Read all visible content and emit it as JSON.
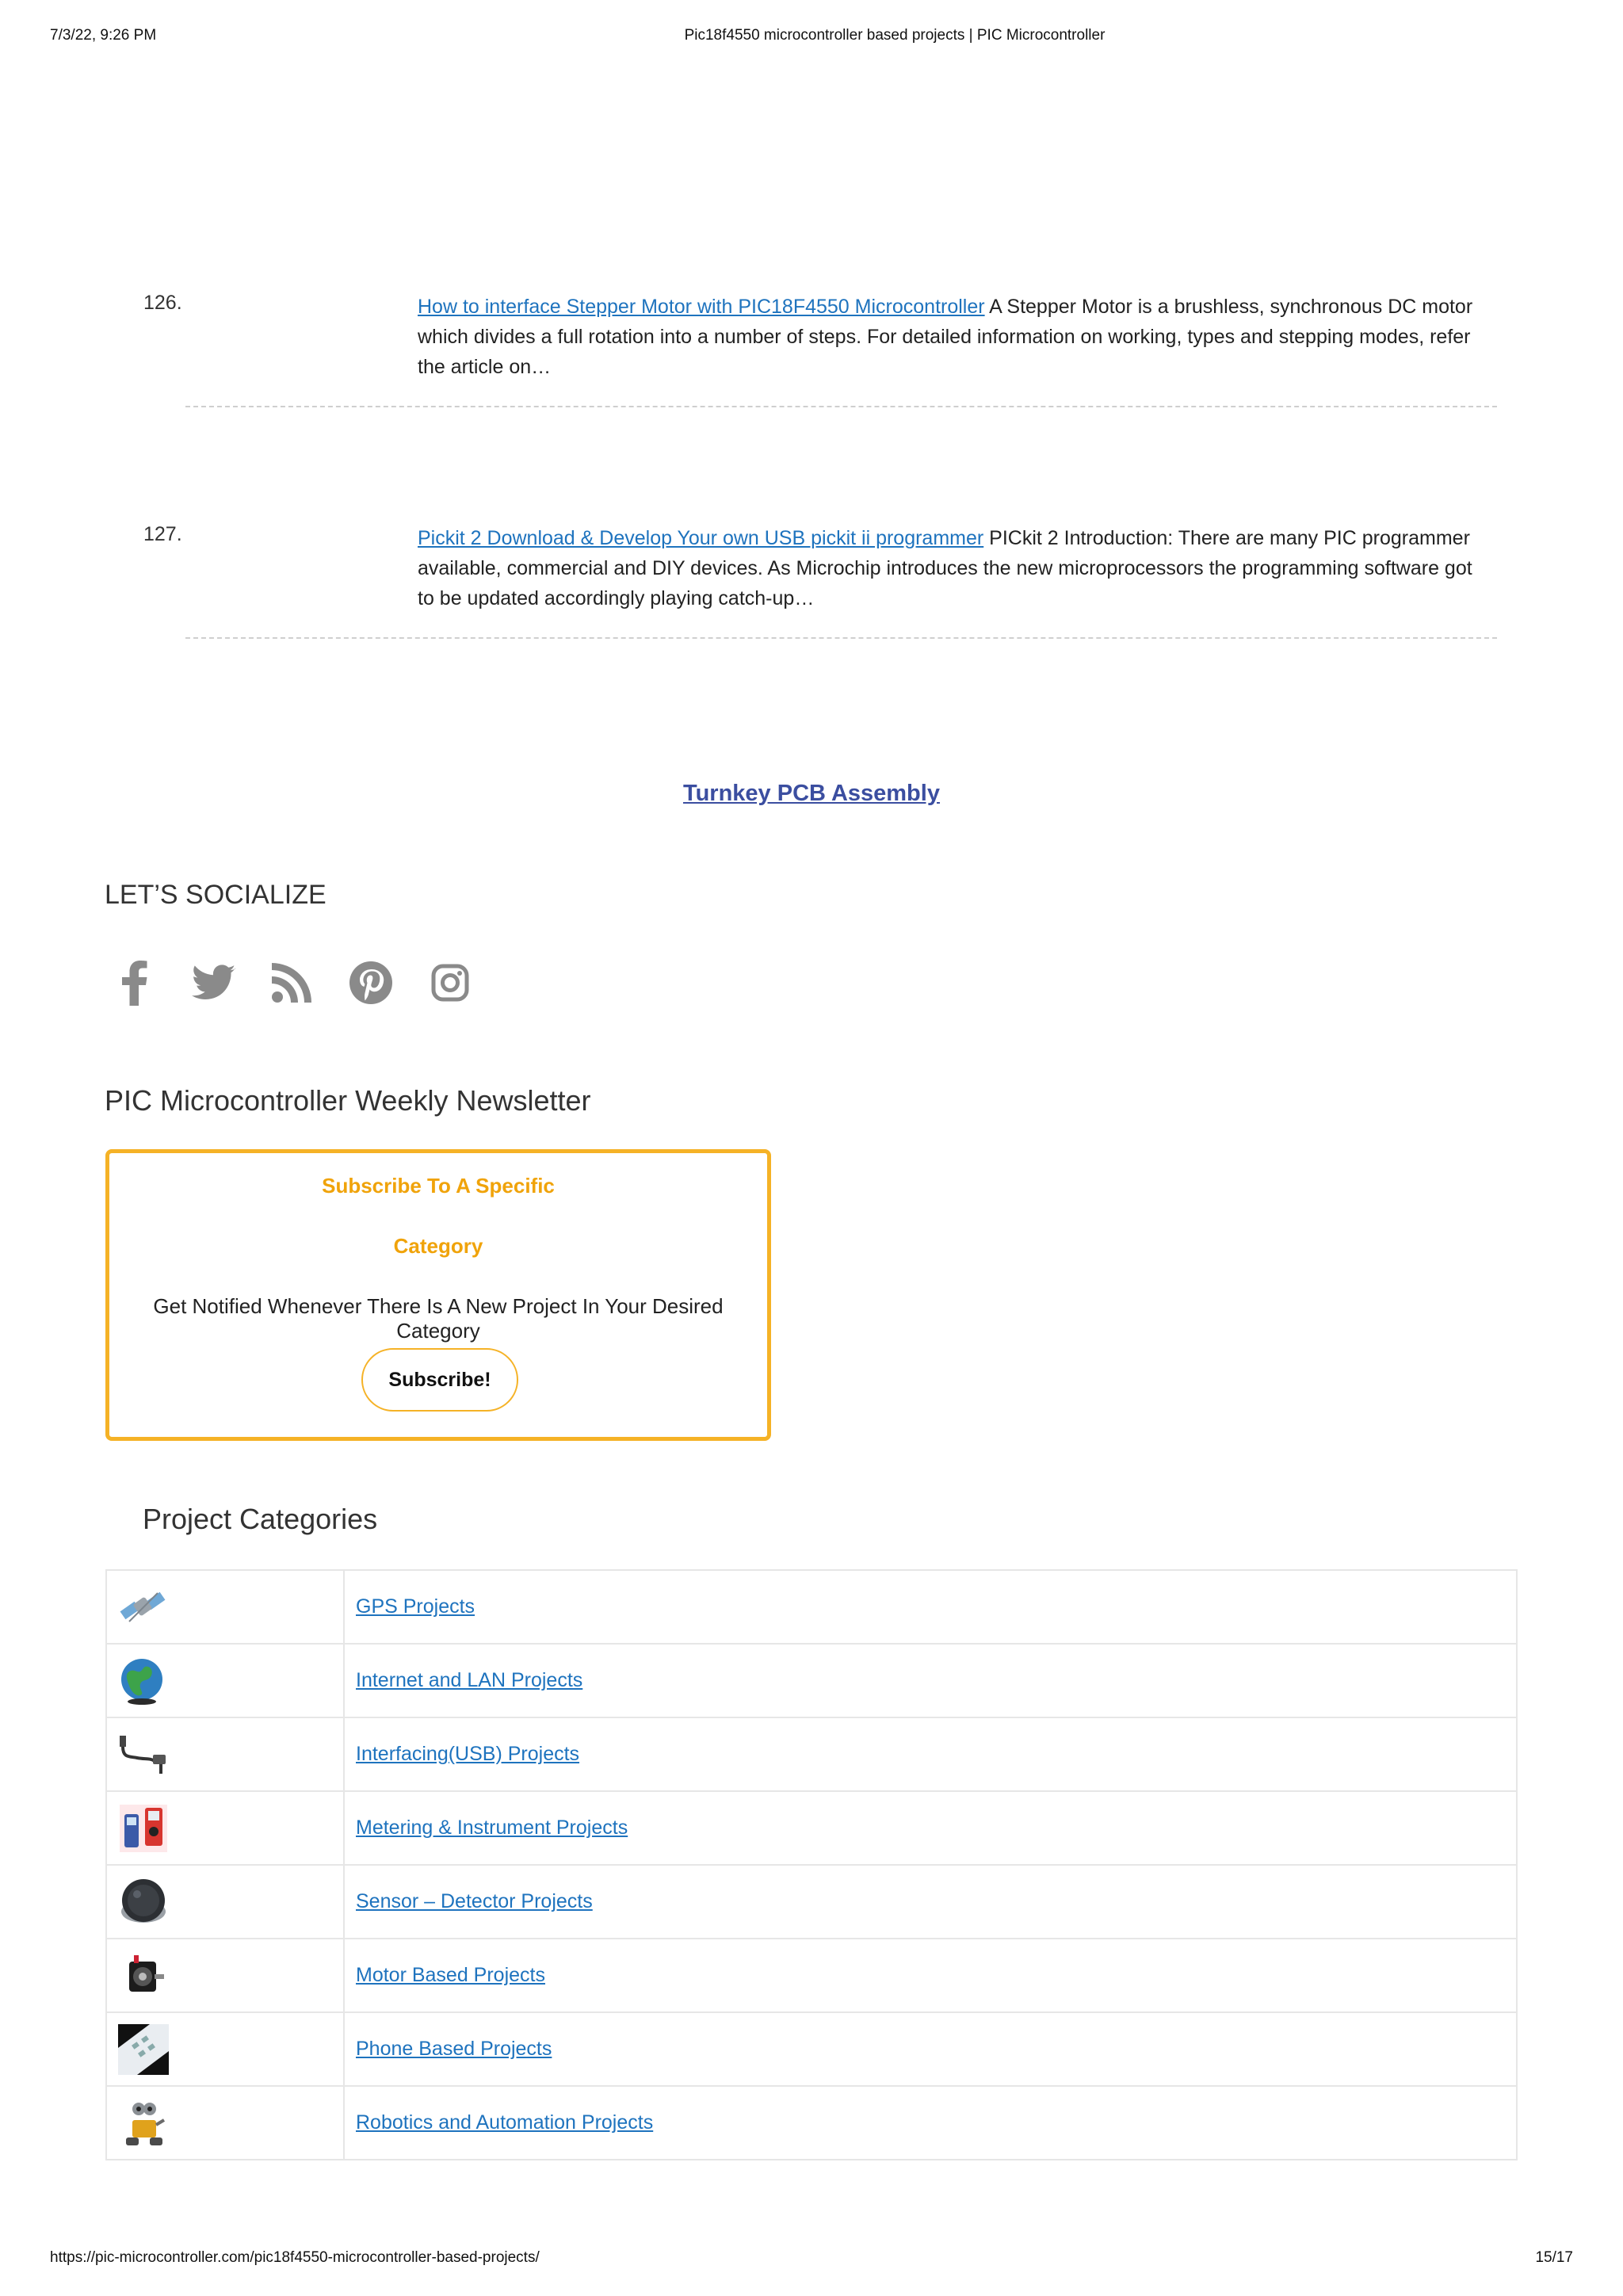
{
  "print_header": {
    "datetime": "7/3/22, 9:26 PM",
    "page_title": "Pic18f4550 microcontroller based projects | PIC Microcontroller"
  },
  "posts": [
    {
      "number": "126.",
      "link_text": "How to interface Stepper Motor with PIC18F4550 Microcontroller",
      "excerpt": " A Stepper Motor is a brushless, synchronous DC motor which divides a full rotation into a number of steps. For detailed information on working, types and stepping modes, refer the article on…"
    },
    {
      "number": "127.",
      "link_text": "Pickit 2 Download & Develop Your own USB pickit ii programmer",
      "excerpt": "   PICkit 2 Introduction: There are many PIC programmer available, commercial and DIY devices. As Microchip introduces the new microprocessors the programming software got to be updated accordingly playing catch-up…"
    }
  ],
  "turnkey_link": "Turnkey PCB Assembly",
  "social": {
    "heading": "LET’S SOCIALIZE",
    "icons": [
      "facebook-icon",
      "twitter-icon",
      "rss-icon",
      "pinterest-icon",
      "instagram-icon"
    ]
  },
  "newsletter": {
    "heading": "PIC Microcontroller Weekly Newsletter",
    "title_line1": "Subscribe To A Specific",
    "title_line2": "Category",
    "description": "Get Notified Whenever There Is A New Project In Your Desired Category",
    "button_label": "Subscribe!"
  },
  "categories": {
    "heading": "Project Categories",
    "items": [
      {
        "label": "GPS Projects",
        "icon": "satellite-icon"
      },
      {
        "label": "Internet and LAN Projects",
        "icon": "globe-icon"
      },
      {
        "label": "Interfacing(USB) Projects",
        "icon": "usb-cable-icon"
      },
      {
        "label": "Metering & Instrument Projects",
        "icon": "multimeter-icon"
      },
      {
        "label": "Sensor – Detector Projects",
        "icon": "sensor-icon"
      },
      {
        "label": "Motor Based Projects",
        "icon": "motor-icon"
      },
      {
        "label": "Phone Based Projects",
        "icon": "phone-keypad-icon"
      },
      {
        "label": "Robotics and Automation Projects",
        "icon": "robot-icon"
      }
    ]
  },
  "print_footer": {
    "url": "https://pic-microcontroller.com/pic18f4550-microcontroller-based-projects/",
    "page": "15/17"
  },
  "colors": {
    "link": "#1e73be",
    "accent": "#f5b226",
    "accent_text": "#f0a30a",
    "social_icon": "#8a8a8a"
  }
}
